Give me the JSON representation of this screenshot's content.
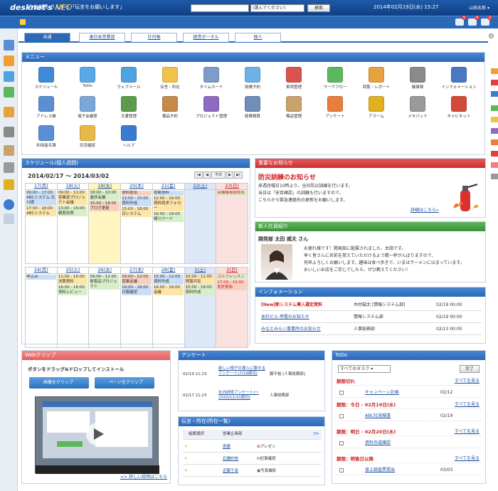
{
  "app": {
    "logo": "desknet's",
    "logo_accent": "NEO",
    "user": "山田太郎"
  },
  "search": {
    "scope": "(選んでください)",
    "button": "検索"
  },
  "message": {
    "text": "寺本部長 さんから「伝言をお願いします」",
    "date": "2014年02月19日(水) 15:27",
    "badges": [
      "5",
      "4",
      "2"
    ]
  },
  "tabs": [
    "共通",
    "東日本営業部",
    "社内報",
    "経営ポータル",
    "個人"
  ],
  "menu": {
    "title": "メニュー",
    "items": [
      {
        "label": "スケジュール",
        "color": "#3f8ad8"
      },
      {
        "label": "ToDo",
        "color": "#5aa9e6"
      },
      {
        "label": "ウェブメール",
        "color": "#4fa3e0"
      },
      {
        "label": "伝言・所在",
        "color": "#f0c24a"
      },
      {
        "label": "タイムカード",
        "color": "#7e9cc9"
      },
      {
        "label": "設備予約",
        "color": "#6db1e6"
      },
      {
        "label": "車両管理",
        "color": "#d9534f"
      },
      {
        "label": "ワークフロー",
        "color": "#5cb85c"
      },
      {
        "label": "回覧・レポート",
        "color": "#e6a23c"
      },
      {
        "label": "議事録",
        "color": "#8a8a8a"
      },
      {
        "label": "インフォメーション",
        "color": "#4a78c2"
      },
      {
        "label": "アドレス帳",
        "color": "#5b8fd2"
      },
      {
        "label": "電子会議室",
        "color": "#7aa6d8"
      },
      {
        "label": "文書管理",
        "color": "#5c9b4d"
      },
      {
        "label": "備品予約",
        "color": "#c58a4a"
      },
      {
        "label": "プロジェクト管理",
        "color": "#8c6bc1"
      },
      {
        "label": "経費精算",
        "color": "#6f8fb8"
      },
      {
        "label": "備品管理",
        "color": "#c9a36b"
      },
      {
        "label": "アンケート",
        "color": "#e87f3a"
      },
      {
        "label": "アラーム",
        "color": "#e0b020"
      },
      {
        "label": "メモパッド",
        "color": "#9a9a9a"
      },
      {
        "label": "キャビネット",
        "color": "#d04a3a"
      },
      {
        "label": "利用者名簿",
        "color": "#5a8ed8"
      },
      {
        "label": "安否確認",
        "color": "#e6b94a"
      },
      {
        "label": "ヘルプ",
        "color": "#3a7ad0"
      }
    ]
  },
  "schedule": {
    "title": "スケジュール(個人週間)",
    "range": "2014/02/17 ～ 2014/03/02",
    "nav": [
      "|◀",
      "◀",
      "今日",
      "▶",
      "▶|"
    ],
    "week1": {
      "days": [
        "17(月)",
        "18(火)",
        "19(水)",
        "20(木)",
        "21(金)",
        "22(土)",
        "23(日)"
      ],
      "events": [
        [
          "06:00 - 17:00 ABCシステム 丸川様",
          "17:00 - 18:00 ABCシステム"
        ],
        [
          "09:00 - 11:00 営業部プロジェクト会議",
          "13:00 - 16:00 顧客訪問"
        ],
        [
          "18:00 - 10:00 進捗会議",
          "15:00 - 18:00 ブログ更新"
        ],
        [
          "資料提出",
          "12:00 - 15:00 資料作成",
          "15:00 - 18:00 日システム"
        ],
        [
          "提案資料",
          "12:00 - 16:00 資料請求フォロー",
          "16:00 - 18:00 関川フード"
        ],
        [],
        [
          "会議議事録提出"
        ]
      ]
    },
    "week2": {
      "days": [
        "24(月)",
        "25(火)",
        "26(水)",
        "27(木)",
        "28(金)",
        "1(土)",
        "2(日)"
      ],
      "events": [
        [
          "申込み"
        ],
        [
          "11:00 - 16:00 決算資料",
          "16:00 - 18:00 資料レビュー"
        ],
        [
          "09:00 - 12:00 新製品プロジェクト"
        ],
        [
          "09:00 - 12:00 営業会議",
          "16:00 - 18:00 日報確認"
        ],
        [
          "10:00 - 12:00 資料作成",
          "16:00 - 18:00 会議"
        ],
        [
          "10:00 - 12:00 情報共有",
          "15:00 - 18:00 資料作成"
        ],
        [
          "ゴルフレッスン",
          "17:00 - 19:00 免許更新"
        ]
      ]
    }
  },
  "notice": {
    "title": "重要なお知らせ",
    "heading": "防災訓練のお知らせ",
    "lines": [
      "来週月曜日10時より、全社防災訓練を行います。",
      "当日は「安否確認」の訓練も行いますので、",
      "こちらから緊急連絡先の更新をお願いします。"
    ],
    "more": "詳細はこちら»"
  },
  "intro": {
    "title": "新入社員紹介",
    "name": "開発部 太田 威夫 さん",
    "lines": [
      "お疲れ様です！開発部に配属されました、太田です。",
      "早く皆さんに名前を覚えていただけるよう精一杯がんばりますので、",
      "何卒よろしくお願いします。趣味は食べ歩きで、いまはラーメンにはまっています。",
      "おいしいお店をご存じでしたら、ぜひ教えてください！"
    ]
  },
  "information": {
    "title": "インフォメーション",
    "rows": [
      {
        "title": "[New]新システム導入選定資料",
        "author": "木村誠太 [情報システム部]",
        "date": "02/19 00:00"
      },
      {
        "title": "本社ビル 停電のお知らせ",
        "author": "情報システム部",
        "date": "02/19 00:00"
      },
      {
        "title": "みなとみらい事業所のお知らせ",
        "author": "人事総務部",
        "date": "02/13 00:00"
      }
    ]
  },
  "webclip": {
    "title": "Webクリップ",
    "desc": "ボタンをドラッグ&ドロップしてインストール",
    "btn1": "画像をクリップ",
    "btn2": "ページをクリップ",
    "more": ">> 詳しい説明はこちら"
  },
  "survey": {
    "title": "アンケート",
    "rows": [
      {
        "date": "02/19 11:23",
        "title": "新しい椅子の導入に関するアンケート(7/19締切)",
        "author": "藤平裕 [人事総務部]"
      },
      {
        "date": "02/17 11:23",
        "title": "社内研修アンケート(～2020/12/31締切)",
        "author": "人事総務部"
      }
    ]
  },
  "reply": {
    "title": "伝言・所在(所在一覧)",
    "cols": [
      "組織選択",
      "営業企画部"
    ],
    "rows": [
      {
        "name": "斎藤",
        "status": "プレゼン"
      },
      {
        "name": "石橋紗枝",
        "status": "記事確認"
      },
      {
        "name": "近藤千尋",
        "status": "写真撮影"
      }
    ]
  },
  "todo": {
    "title": "ToDo",
    "filter": "すべてのタスク",
    "done_btn": "完了",
    "more": "すべてを見る",
    "sections": [
      {
        "label": "期限切れ",
        "items": [
          {
            "title": "キャンペーン計画",
            "date": "02/12"
          }
        ]
      },
      {
        "label": "期限：今日 - 02月19日(水)",
        "items": [
          {
            "title": "ABC社見積書",
            "date": "02/19"
          }
        ]
      },
      {
        "label": "期限：明日 - 02月20日(木)",
        "items": [
          {
            "title": "資料作成確認",
            "date": ""
          }
        ]
      },
      {
        "label": "期限：明後日以降",
        "items": [
          {
            "title": "身上調査票提出",
            "date": "03/03"
          }
        ]
      }
    ]
  }
}
